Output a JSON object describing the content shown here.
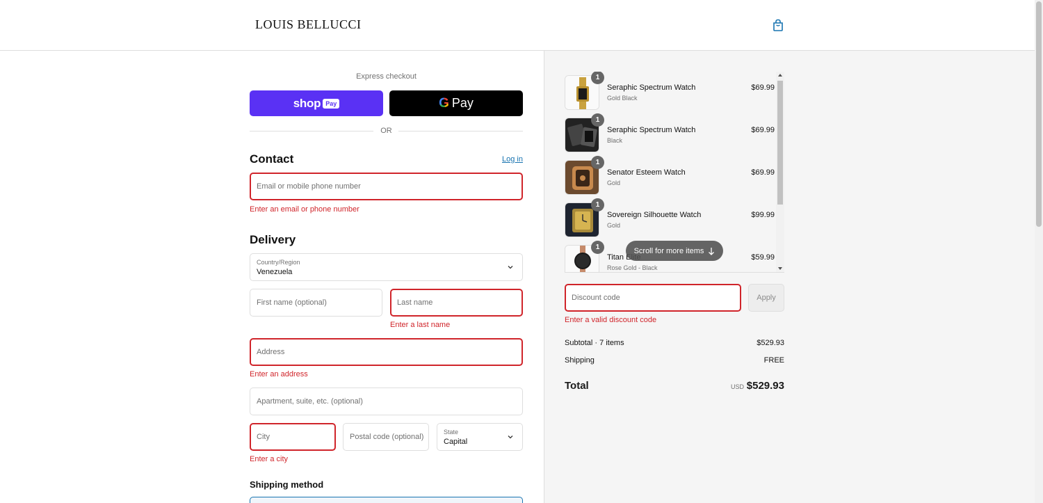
{
  "brand": {
    "logo_text": "LOUIS BELLUCCI"
  },
  "express": {
    "label": "Express checkout",
    "shop_pay_text": "shop",
    "shop_pay_badge": "Pay",
    "gpay_letter": "G",
    "gpay_text": "Pay",
    "or_text": "OR"
  },
  "contact": {
    "title": "Contact",
    "login_label": "Log in",
    "email_placeholder": "Email or mobile phone number",
    "email_error": "Enter an email or phone number"
  },
  "delivery": {
    "title": "Delivery",
    "country_label": "Country/Region",
    "country_value": "Venezuela",
    "first_name_placeholder": "First name (optional)",
    "last_name_placeholder": "Last name",
    "last_name_error": "Enter a last name",
    "address_placeholder": "Address",
    "address_error": "Enter an address",
    "apartment_placeholder": "Apartment, suite, etc. (optional)",
    "city_placeholder": "City",
    "city_error": "Enter a city",
    "postal_placeholder": "Postal code (optional)",
    "state_label": "State",
    "state_value": "Capital",
    "shipping_method_title": "Shipping method"
  },
  "cart": {
    "items": [
      {
        "name": "Seraphic Spectrum Watch",
        "variant": "Gold Black",
        "price": "$69.99",
        "qty": "1"
      },
      {
        "name": "Seraphic Spectrum Watch",
        "variant": "Black",
        "price": "$69.99",
        "qty": "1"
      },
      {
        "name": "Senator Esteem Watch",
        "variant": "Gold",
        "price": "$69.99",
        "qty": "1"
      },
      {
        "name": "Sovereign Silhouette Watch",
        "variant": "Gold",
        "price": "$99.99",
        "qty": "1"
      },
      {
        "name": "Titan Elite",
        "variant": "Rose Gold - Black",
        "price": "$59.99",
        "qty": "1"
      }
    ],
    "scroll_hint": "Scroll for more items",
    "discount_placeholder": "Discount code",
    "apply_label": "Apply",
    "discount_error": "Enter a valid discount code"
  },
  "summary": {
    "subtotal_label": "Subtotal · 7 items",
    "subtotal_value": "$529.93",
    "shipping_label": "Shipping",
    "shipping_value": "FREE",
    "total_label": "Total",
    "currency": "USD",
    "total_value": "$529.93"
  },
  "colors": {
    "error": "#d0242a",
    "link": "#1773b0",
    "shop_pay": "#5a31f4",
    "gpay": "#000000"
  }
}
